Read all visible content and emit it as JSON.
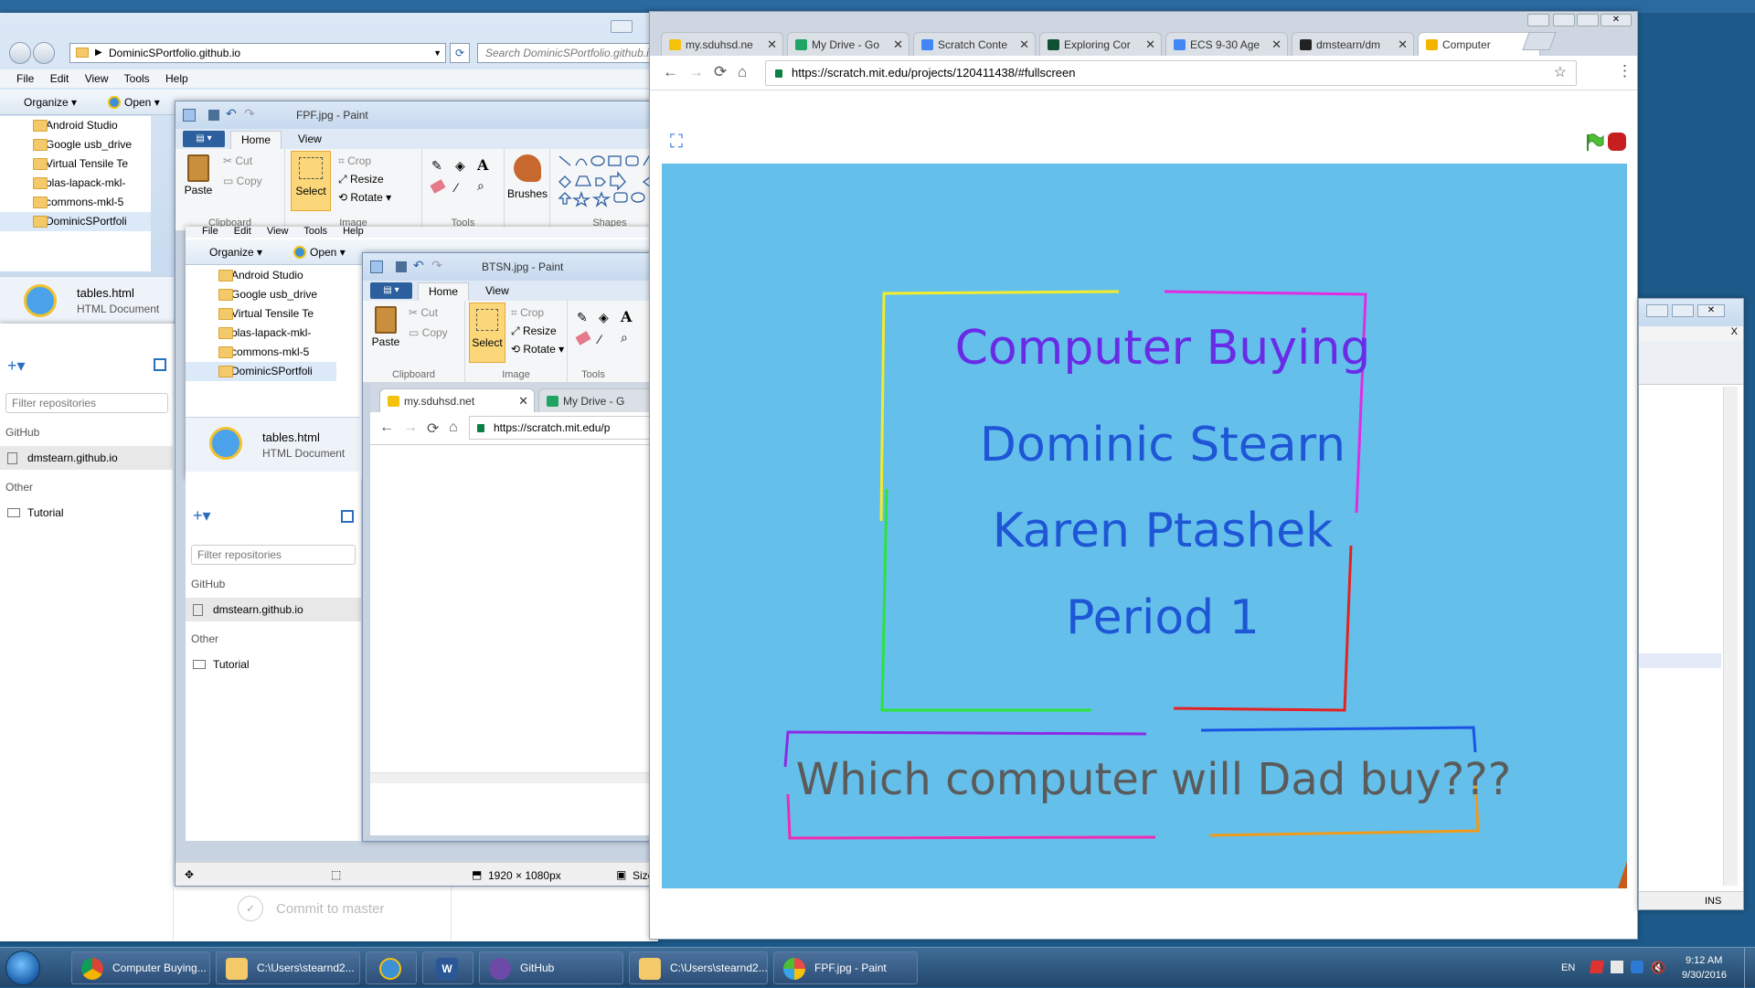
{
  "explorer": {
    "path": "DominicSPortfolio.github.io",
    "search_placeholder": "Search DominicSPortfolio.github.io",
    "menu": [
      "File",
      "Edit",
      "View",
      "Tools",
      "Help"
    ],
    "organize": "Organize",
    "open": "Open",
    "folders": [
      "Android Studio",
      "Google usb_drive",
      "Virtual Tensile Te",
      "blas-lapack-mkl-",
      "commons-mkl-5",
      "DominicSPortfoli"
    ],
    "file_name": "tables.html",
    "file_type": "HTML Document"
  },
  "github": {
    "filter_placeholder": "Filter repositories",
    "github_header": "GitHub",
    "repo": "dmstearn.github.io",
    "other_header": "Other",
    "tutorial": "Tutorial",
    "commit": "Commit to master"
  },
  "paint1": {
    "title": "FPF.jpg - Paint",
    "tabs": [
      "Home",
      "View"
    ],
    "paste": "Paste",
    "cut": "Cut",
    "copy": "Copy",
    "select": "Select",
    "crop": "Crop",
    "resize": "Resize",
    "rotate": "Rotate",
    "brushes": "Brushes",
    "groups": [
      "Clipboard",
      "Image",
      "Tools",
      "Shapes"
    ],
    "status_dims": "1920 × 1080px",
    "status_size": "Size"
  },
  "paint2": {
    "title": "BTSN.jpg - Paint",
    "tabs": [
      "Home",
      "View"
    ],
    "paste": "Paste",
    "cut": "Cut",
    "copy": "Copy",
    "select": "Select",
    "crop": "Crop",
    "resize": "Resize",
    "rotate": "Rotate",
    "groups": [
      "Clipboard",
      "Image",
      "Tools"
    ]
  },
  "explorer2": {
    "menu": [
      "File",
      "Edit",
      "View",
      "Tools",
      "Help"
    ],
    "organize": "Organize",
    "open": "Open"
  },
  "chrome_small": {
    "tabs": [
      "my.sduhsd.net",
      "My Drive - G"
    ],
    "url": "https://scratch.mit.edu/p"
  },
  "chrome": {
    "tabs": [
      {
        "label": "my.sduhsd.ne",
        "color": "#f4c20d"
      },
      {
        "label": "My Drive - Go",
        "color": "#1fa463"
      },
      {
        "label": "Scratch Conte",
        "color": "#4285f4"
      },
      {
        "label": "Exploring Cor",
        "color": "#0f5132"
      },
      {
        "label": "ECS 9-30 Age",
        "color": "#4285f4"
      },
      {
        "label": "dmstearn/dm",
        "color": "#222222"
      },
      {
        "label": "Computer",
        "color": "#f4b400"
      }
    ],
    "url": "https://scratch.mit.edu/projects/120411438/#fullscreen"
  },
  "scratch": {
    "line1": "Computer Buying",
    "line2": "Dominic Stearn",
    "line3": "Karen Ptashek",
    "line4": "Period 1",
    "question": "Which computer will Dad buy???",
    "stage_color": "#64c0ea"
  },
  "notepad": {
    "ins": "INS"
  },
  "taskbar": {
    "items": [
      "Computer Buying...",
      "C:\\Users\\stearnd2...",
      "",
      "",
      "GitHub",
      "C:\\Users\\stearnd2...",
      "FPF.jpg - Paint"
    ],
    "lang": "EN",
    "time": "9:12 AM",
    "date": "9/30/2016"
  }
}
